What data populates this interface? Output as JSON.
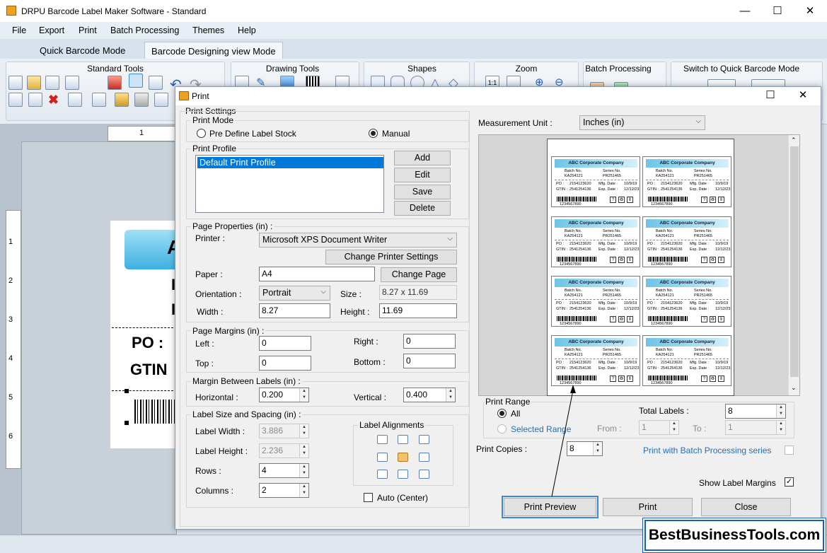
{
  "app": {
    "title": "DRPU Barcode Label Maker Software - Standard"
  },
  "window_controls": {
    "minimize": "—",
    "maximize": "☐",
    "close": "✕"
  },
  "menu": [
    "File",
    "Export",
    "Print",
    "Batch Processing",
    "Themes",
    "Help"
  ],
  "mode_tabs": [
    "Quick Barcode Mode",
    "Barcode Designing view Mode"
  ],
  "ribbon": {
    "groups": [
      "Standard Tools",
      "Drawing Tools",
      "Shapes",
      "Zoom",
      "Batch Processing",
      "Switch to Quick Barcode Mode"
    ]
  },
  "canvas": {
    "ruler_top": [
      "1"
    ],
    "ruler_left": [
      "1",
      "2",
      "3",
      "4",
      "5",
      "6"
    ],
    "label_text": [
      "A",
      "I",
      "I",
      "PO :",
      "GTIN"
    ]
  },
  "dialog": {
    "title": "Print",
    "controls": {
      "maximize": "☐",
      "close": "✕"
    },
    "print_settings_label": "Print Settings",
    "print_mode": {
      "legend": "Print Mode",
      "options": [
        "Pre Define Label Stock",
        "Manual"
      ],
      "selected": "Manual"
    },
    "print_profile": {
      "legend": "Print Profile",
      "items": [
        "Default Print Profile"
      ],
      "buttons": [
        "Add",
        "Edit",
        "Save",
        "Delete"
      ]
    },
    "page_properties": {
      "legend": "Page Properties (in) :",
      "printer_label": "Printer :",
      "printer": "Microsoft XPS Document Writer",
      "change_printer": "Change Printer Settings",
      "paper_label": "Paper :",
      "paper": "A4",
      "change_page": "Change Page",
      "orientation_label": "Orientation :",
      "orientation": "Portrait",
      "size_label": "Size :",
      "size": "8.27 x 11.69",
      "width_label": "Width :",
      "width": "8.27",
      "height_label": "Height :",
      "height": "11.69"
    },
    "page_margins": {
      "legend": "Page Margins (in) :",
      "left_label": "Left :",
      "left": "0",
      "right_label": "Right :",
      "right": "0",
      "top_label": "Top :",
      "top": "0",
      "bottom_label": "Bottom :",
      "bottom": "0"
    },
    "margin_between": {
      "legend": "Margin Between Labels (in) :",
      "horizontal_label": "Horizontal :",
      "horizontal": "0.200",
      "vertical_label": "Vertical :",
      "vertical": "0.400"
    },
    "label_size": {
      "legend": "Label Size and Spacing (in) :",
      "width_label": "Label Width :",
      "width": "3.886",
      "height_label": "Label Height :",
      "height": "2.236",
      "rows_label": "Rows :",
      "rows": "4",
      "columns_label": "Columns :",
      "columns": "2"
    },
    "alignments": {
      "legend": "Label Alignments",
      "auto_center": "Auto (Center)"
    },
    "measurement": {
      "label": "Measurement Unit :",
      "value": "Inches (in)"
    },
    "preview_label": {
      "company": "ABC Corporate Company",
      "batch_label": "Batch No.",
      "batch": "KA254121",
      "series_label": "Series No.",
      "series": "PR251465",
      "po": "PO :",
      "po_val": "2154123620",
      "gtin": "GTIN :",
      "gtin_val": "2541254136",
      "mfg": "Mfg. Date :",
      "mfg_val": "10/9/19",
      "exp": "Exp. Date :",
      "exp_val": "12/12/23",
      "barcode_num": "1234567890"
    },
    "print_range": {
      "legend": "Print Range",
      "all": "All",
      "selected_range": "Selected Range",
      "from_label": "From :",
      "from": "1",
      "to_label": "To :",
      "to": "1",
      "total_label": "Total Labels :",
      "total": "8"
    },
    "print_copies": {
      "label": "Print Copies :",
      "value": "8"
    },
    "batch_series": "Print with Batch Processing series",
    "show_margins": "Show Label Margins",
    "buttons": {
      "preview": "Print Preview",
      "print": "Print",
      "close": "Close"
    }
  },
  "watermark": "BestBusinessTools.com"
}
